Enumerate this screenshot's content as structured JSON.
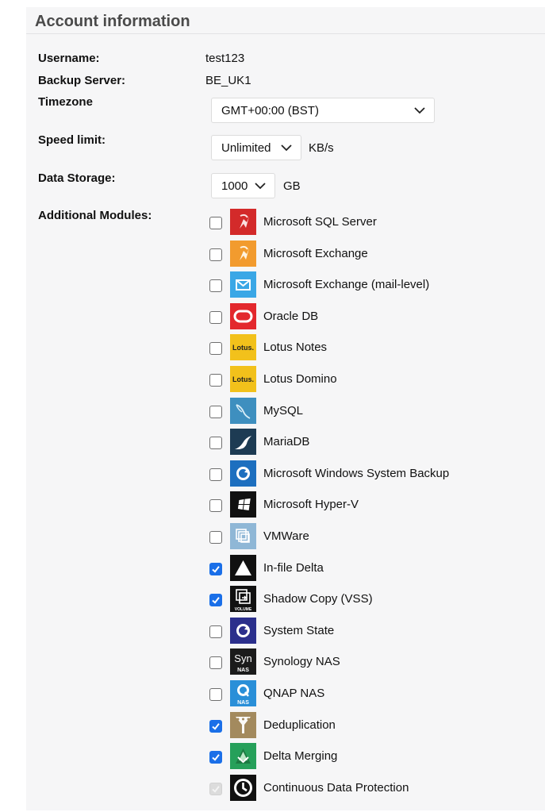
{
  "section": {
    "title": "Account information"
  },
  "fields": {
    "username_label": "Username:",
    "username_value": "test123",
    "backup_server_label": "Backup Server:",
    "backup_server_value": "BE_UK1",
    "timezone_label": "Timezone",
    "timezone_value": "GMT+00:00 (BST)",
    "speed_limit_label": "Speed limit:",
    "speed_limit_value": "Unlimited",
    "speed_limit_unit": "KB/s",
    "data_storage_label": "Data Storage:",
    "data_storage_value": "1000",
    "data_storage_unit": "GB",
    "modules_label": "Additional Modules:"
  },
  "colors": {
    "checkbox_accent": "#1a6fe8"
  },
  "modules": [
    {
      "label": "Microsoft SQL Server",
      "icon": "mssql-icon",
      "checked": false,
      "disabled": false
    },
    {
      "label": "Microsoft Exchange",
      "icon": "exchange-icon",
      "checked": false,
      "disabled": false
    },
    {
      "label": "Microsoft Exchange (mail-level)",
      "icon": "exchange-mail-icon",
      "checked": false,
      "disabled": false
    },
    {
      "label": "Oracle DB",
      "icon": "oracle-icon",
      "checked": false,
      "disabled": false
    },
    {
      "label": "Lotus Notes",
      "icon": "lotus-notes-icon",
      "icon_text": "Lotus.",
      "checked": false,
      "disabled": false
    },
    {
      "label": "Lotus Domino",
      "icon": "lotus-domino-icon",
      "icon_text": "Lotus.",
      "checked": false,
      "disabled": false
    },
    {
      "label": "MySQL",
      "icon": "mysql-icon",
      "checked": false,
      "disabled": false
    },
    {
      "label": "MariaDB",
      "icon": "mariadb-icon",
      "checked": false,
      "disabled": false
    },
    {
      "label": "Microsoft Windows System Backup",
      "icon": "windows-system-backup-icon",
      "checked": false,
      "disabled": false
    },
    {
      "label": "Microsoft Hyper-V",
      "icon": "hyper-v-icon",
      "checked": false,
      "disabled": false
    },
    {
      "label": "VMWare",
      "icon": "vmware-icon",
      "checked": false,
      "disabled": false
    },
    {
      "label": "In-file Delta",
      "icon": "in-file-delta-icon",
      "checked": true,
      "disabled": false
    },
    {
      "label": "Shadow Copy (VSS)",
      "icon": "shadow-copy-icon",
      "icon_text": "VOLUME",
      "checked": true,
      "disabled": false
    },
    {
      "label": "System State",
      "icon": "system-state-icon",
      "checked": false,
      "disabled": false
    },
    {
      "label": "Synology NAS",
      "icon": "synology-icon",
      "icon_text": "Syn",
      "icon_subtext": "NAS",
      "checked": false,
      "disabled": false
    },
    {
      "label": "QNAP NAS",
      "icon": "qnap-icon",
      "icon_text": "NAS",
      "checked": false,
      "disabled": false
    },
    {
      "label": "Deduplication",
      "icon": "deduplication-icon",
      "checked": true,
      "disabled": false
    },
    {
      "label": "Delta Merging",
      "icon": "delta-merging-icon",
      "checked": true,
      "disabled": false
    },
    {
      "label": "Continuous Data Protection",
      "icon": "continuous-data-protection-icon",
      "checked": true,
      "disabled": true
    }
  ]
}
